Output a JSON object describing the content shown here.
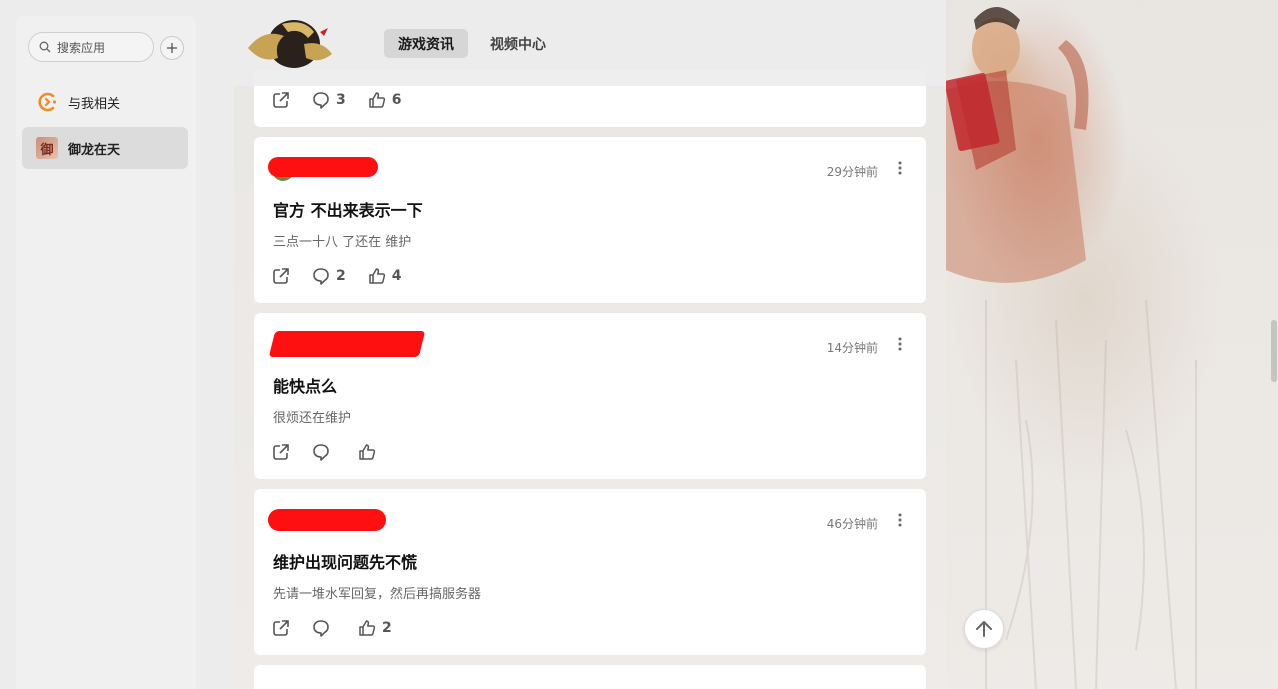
{
  "sidebar": {
    "search_placeholder": "搜索应用",
    "items": [
      {
        "label": "与我相关",
        "icon": "mention-icon"
      },
      {
        "label": "御龙在天",
        "icon": "app-thumbnail"
      }
    ],
    "app_thumb_glyph": "御"
  },
  "header": {
    "tabs": [
      {
        "label": "游戏资讯",
        "active": true
      },
      {
        "label": "视频中心",
        "active": false
      }
    ]
  },
  "feed": {
    "partial_card": {
      "comments": "3",
      "likes": "6"
    },
    "posts": [
      {
        "time": "29分钟前",
        "title": "官方 不出来表示一下",
        "body": "三点一十八 了还在 维护",
        "comments": "2",
        "likes": "4"
      },
      {
        "time": "14分钟前",
        "title": "能快点么",
        "body": "很烦还在维护",
        "comments": "",
        "likes": ""
      },
      {
        "time": "46分钟前",
        "title": "维护出现问题先不慌",
        "body": "先请一堆水军回复，然后再搞服务器",
        "comments": "",
        "likes": "2"
      }
    ]
  },
  "colors": {
    "accent": "#f08c1e",
    "redaction": "#ff1010",
    "card_bg": "#ffffff"
  }
}
